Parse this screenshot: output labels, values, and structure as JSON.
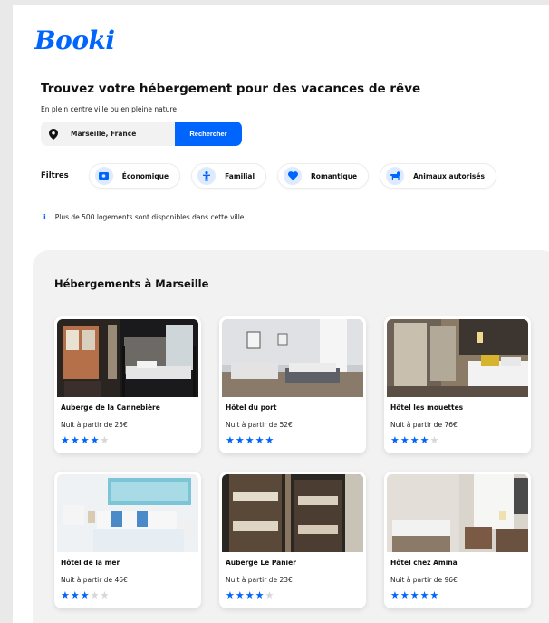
{
  "brand": {
    "logo_text": "Booki",
    "accent": "#0065FC"
  },
  "hero": {
    "title": "Trouvez votre hébergement pour des vacances de rêve",
    "subtitle": "En plein centre ville ou en pleine nature"
  },
  "search": {
    "value": "Marseille, France",
    "button_label": "Rechercher",
    "icon": "location-pin-icon"
  },
  "filters": {
    "label": "Filtres",
    "items": [
      {
        "label": "Économique",
        "icon": "money-icon"
      },
      {
        "label": "Familial",
        "icon": "child-icon"
      },
      {
        "label": "Romantique",
        "icon": "heart-icon"
      },
      {
        "label": "Animaux autorisés",
        "icon": "dog-icon"
      }
    ]
  },
  "info": {
    "icon": "info-icon",
    "text": "Plus de 500 logements sont disponibles dans cette ville"
  },
  "listings": {
    "title": "Hébergements à Marseille",
    "cards": [
      {
        "name": "Auberge de la Cannebière",
        "price": "Nuit à partir de 25€",
        "rating": 4
      },
      {
        "name": "Hôtel du port",
        "price": "Nuit à partir de 52€",
        "rating": 5
      },
      {
        "name": "Hôtel les mouettes",
        "price": "Nuit à partir de 76€",
        "rating": 4
      },
      {
        "name": "Hôtel de la mer",
        "price": "Nuit à partir de 46€",
        "rating": 3
      },
      {
        "name": "Auberge Le Panier",
        "price": "Nuit à partir de 23€",
        "rating": 4
      },
      {
        "name": "Hôtel chez Amina",
        "price": "Nuit à partir de 96€",
        "rating": 5
      }
    ]
  }
}
